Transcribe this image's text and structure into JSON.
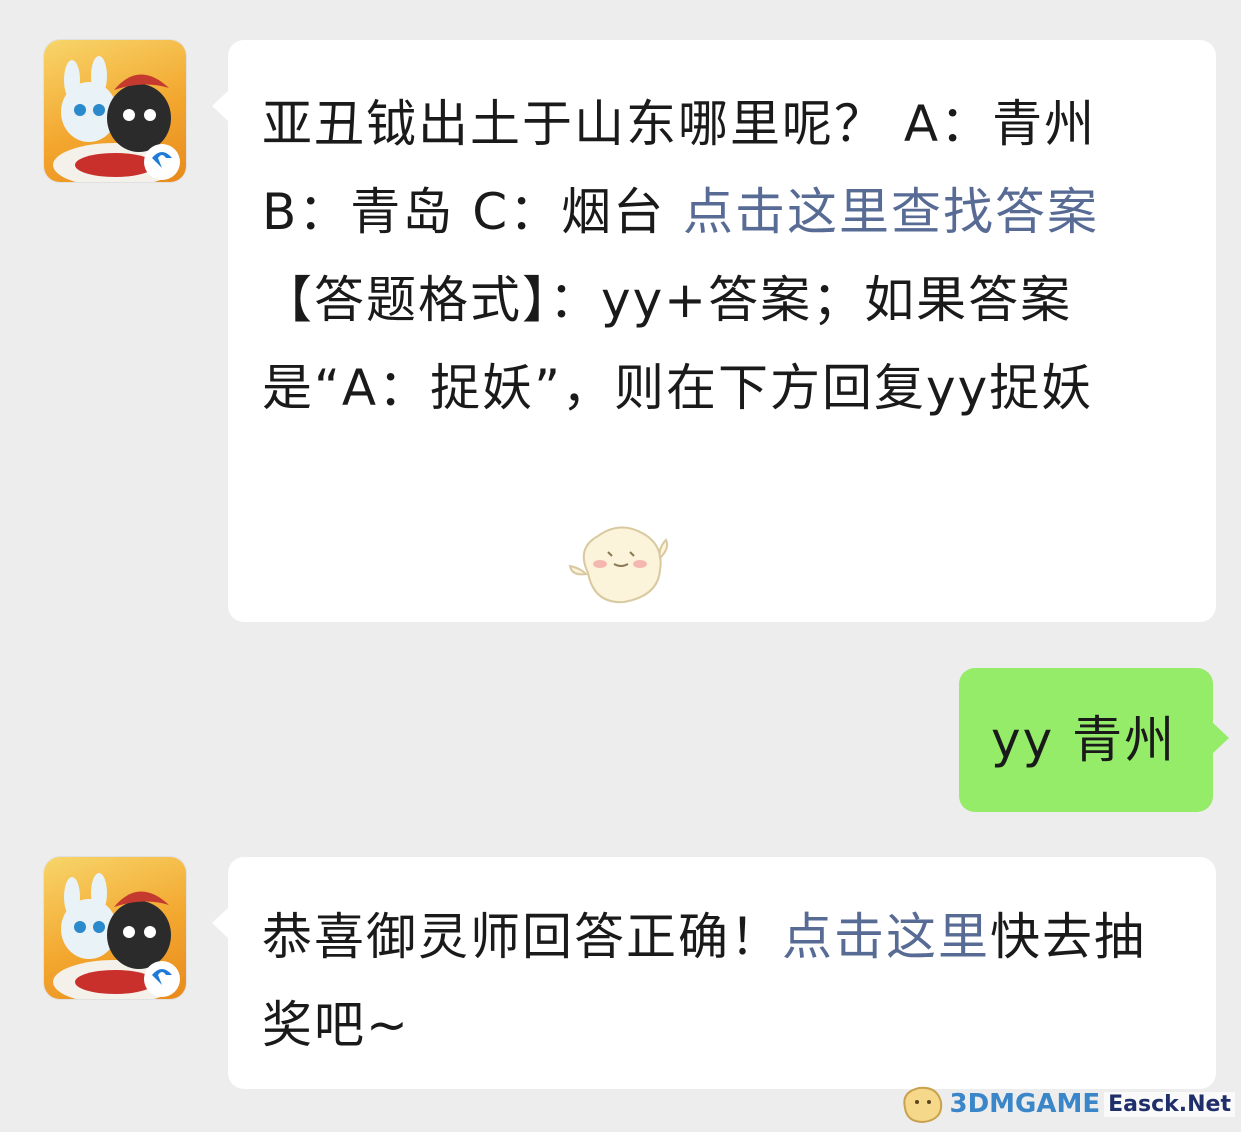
{
  "messages": [
    {
      "side": "left",
      "text_before": "亚丑钺出土于山东哪里呢？ A：青州 B：青岛 C：烟台 ",
      "link": "点击这里查找答案",
      "format_line": "【答题格式】：yy+答案；如果答案是“A：捉妖”，则在下方回复yy捉妖",
      "sticker": "chick-sticker"
    },
    {
      "side": "right",
      "text": "yy 青州"
    },
    {
      "side": "left",
      "text_before": "恭喜御灵师回答正确！",
      "link": "点击这里",
      "text_after": "快去抽奖吧~"
    }
  ],
  "avatar_icon": "game-app-icon",
  "watermark": {
    "brand": "3DMGAME",
    "site": "Easck.Net"
  },
  "colors": {
    "background": "#ededed",
    "bubble_left": "#ffffff",
    "bubble_right": "#95ec69",
    "link": "#576b95"
  }
}
